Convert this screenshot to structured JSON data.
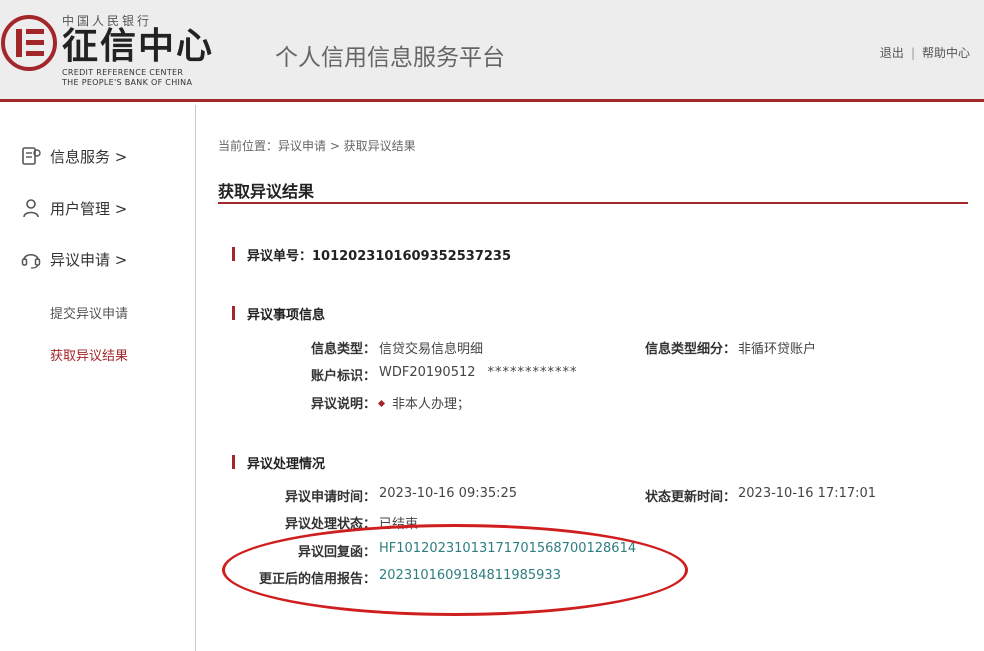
{
  "header": {
    "logo_top_text": "中国人民银行",
    "logo_main_text": "征信中心",
    "logo_en_line1": "CREDIT REFERENCE CENTER",
    "logo_en_line2": "THE PEOPLE'S BANK OF CHINA",
    "platform_title": "个人信用信息服务平台",
    "logout_label": "退出",
    "separator": "|",
    "help_label": "帮助中心"
  },
  "sidebar": {
    "items": [
      {
        "label": "信息服务 >",
        "icon": "document-icon"
      },
      {
        "label": "用户管理 >",
        "icon": "user-icon"
      },
      {
        "label": "异议申请 >",
        "icon": "headset-icon"
      }
    ],
    "sub_items": [
      {
        "label": "提交异议申请",
        "active": false
      },
      {
        "label": "获取异议结果",
        "active": true
      }
    ]
  },
  "main": {
    "breadcrumb": "当前位置：异议申请 > 获取异议结果",
    "page_title": "获取异议结果",
    "dispute_number_label": "异议单号：1012023101609352537235",
    "dispute_info": {
      "heading": "异议事项信息",
      "info_type_label": "信息类型：",
      "info_type_value": "信贷交易信息明细",
      "info_subtype_label": "信息类型细分：",
      "info_subtype_value": "非循环贷账户",
      "account_label": "账户标识：",
      "account_value": "WDF20190512",
      "account_masked": "************",
      "description_label": "异议说明：",
      "description_value": "非本人办理；"
    },
    "processing": {
      "heading": "异议处理情况",
      "apply_time_label": "异议申请时间：",
      "apply_time_value": "2023-10-16 09:35:25",
      "update_time_label": "状态更新时间：",
      "update_time_value": "2023-10-16 17:17:01",
      "status_label": "异议处理状态：",
      "status_value": "已结束",
      "reply_label": "异议回复函：",
      "reply_value": "HF10120231013171701568700128614",
      "report_label": "更正后的信用报告：",
      "report_value": "2023101609184811985933"
    }
  },
  "colors": {
    "brand_red": "#a3262a",
    "link_teal": "#2f7d80",
    "annotation_red": "#d01e1e"
  }
}
